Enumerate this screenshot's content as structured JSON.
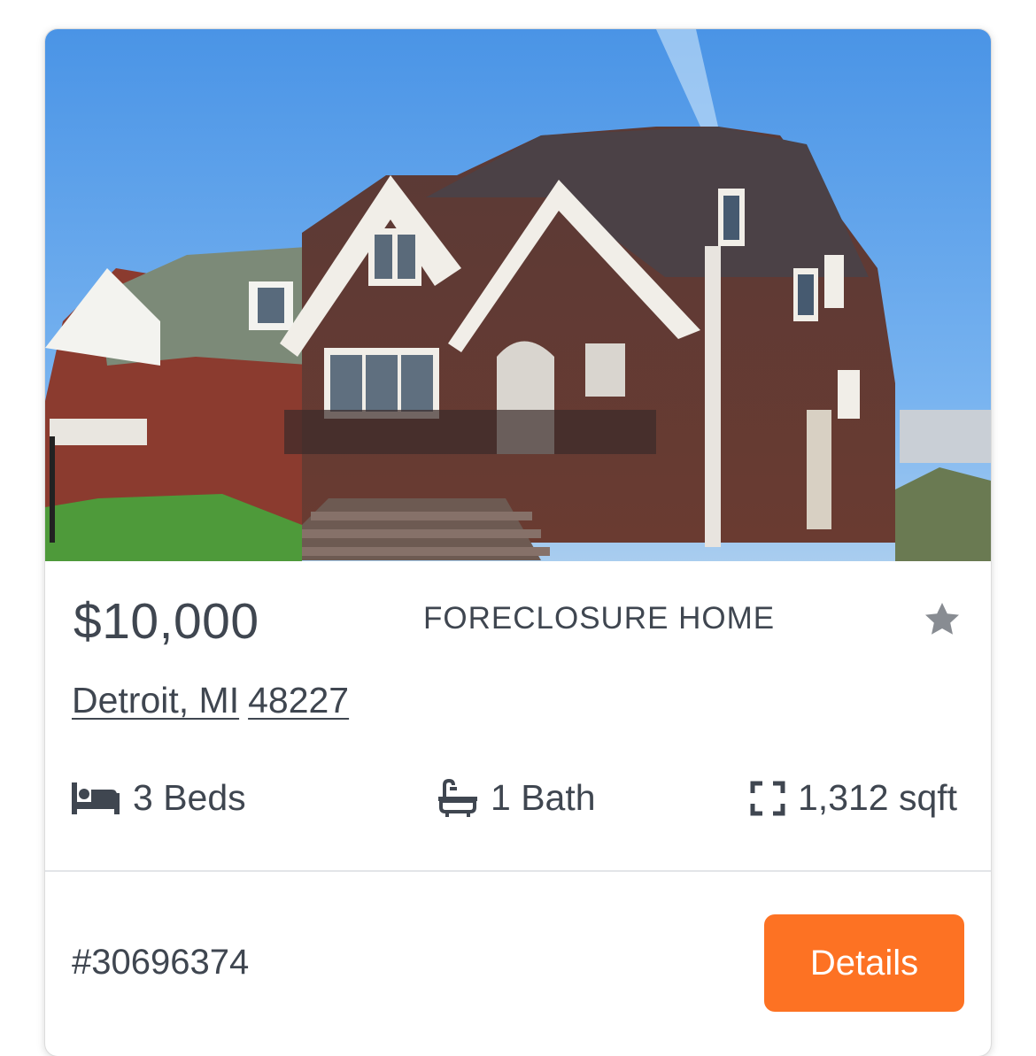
{
  "listing": {
    "price": "$10,000",
    "property_type": "FORECLOSURE HOME",
    "city_state": "Detroit, MI",
    "zip": "48227",
    "beds": "3 Beds",
    "baths": "1 Bath",
    "area": "1,312 sqft",
    "listing_id": "#30696374",
    "details_label": "Details"
  },
  "icons": {
    "favorite": "star-icon",
    "beds": "bed-icon",
    "baths": "bathtub-icon",
    "area": "expand-icon"
  },
  "colors": {
    "accent": "#fd7223",
    "text": "#3f4650",
    "icon": "#888c92"
  }
}
